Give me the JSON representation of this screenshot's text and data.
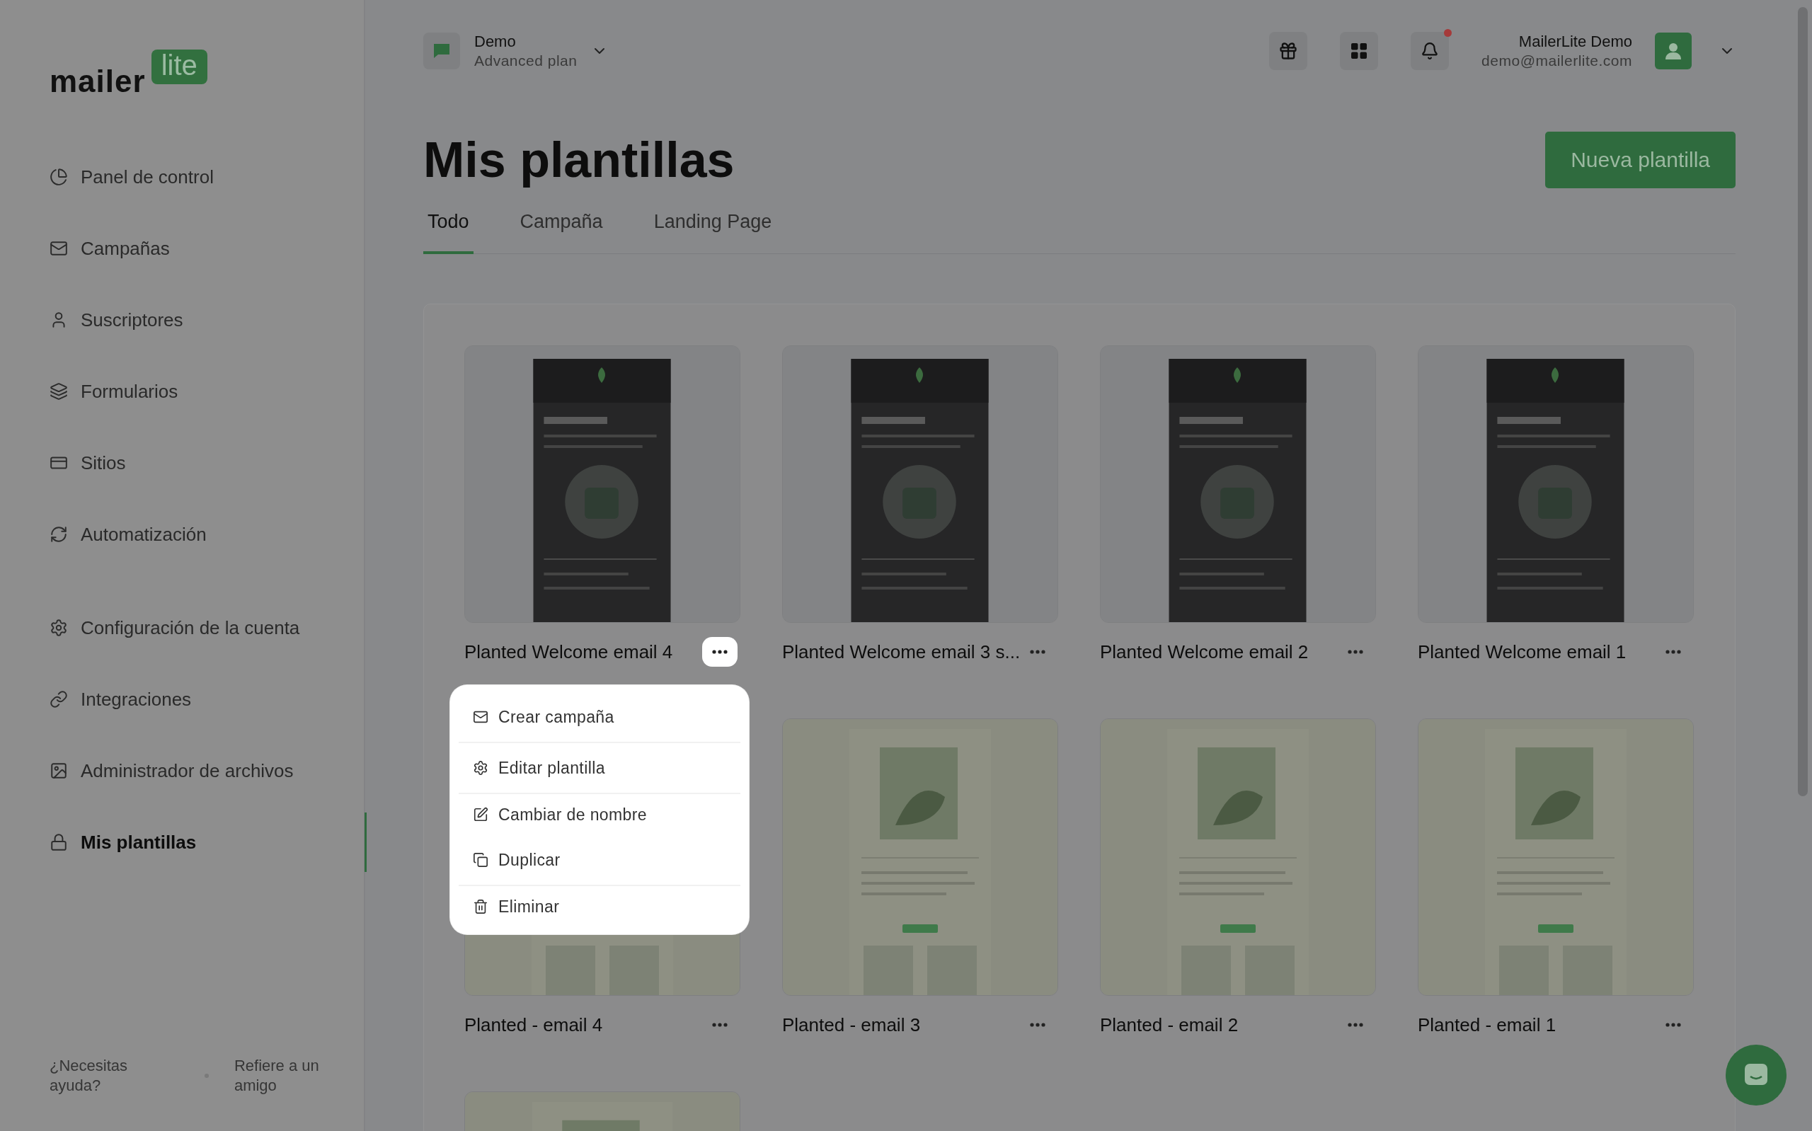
{
  "sidebar": {
    "logo": {
      "word": "mailer",
      "badge": "lite"
    },
    "sections": [
      {
        "items": [
          {
            "label": "Panel de control",
            "selected": false
          },
          {
            "label": "Campañas",
            "selected": false
          },
          {
            "label": "Suscriptores",
            "selected": false
          },
          {
            "label": "Formularios",
            "selected": false
          },
          {
            "label": "Sitios",
            "selected": false
          },
          {
            "label": "Automatización",
            "selected": false
          }
        ]
      },
      {
        "items": [
          {
            "label": "Configuración de la cuenta",
            "selected": false
          },
          {
            "label": "Integraciones",
            "selected": false
          },
          {
            "label": "Administrador de archivos",
            "selected": false
          },
          {
            "label": "Mis plantillas",
            "selected": true
          }
        ]
      }
    ],
    "footer": [
      "¿Necesitas ayuda?",
      "Refiere a un amigo"
    ]
  },
  "header": {
    "workspace": {
      "name": "Demo",
      "plan": "Advanced plan"
    },
    "has_notification": true,
    "user": {
      "name": "MailerLite Demo",
      "email": "demo@mailerlite.com"
    }
  },
  "page": {
    "title": "Mis plantillas",
    "new_button": "Nueva plantilla",
    "tabs": [
      {
        "label": "Todo",
        "selected": true
      },
      {
        "label": "Campaña",
        "selected": false
      },
      {
        "label": "Landing Page",
        "selected": false
      }
    ]
  },
  "templates": [
    {
      "name": "Planted Welcome email 4",
      "kind": "dark",
      "menu_open": true
    },
    {
      "name": "Planted Welcome email 3 s...",
      "kind": "dark",
      "menu_open": false
    },
    {
      "name": "Planted Welcome email 2",
      "kind": "dark",
      "menu_open": false
    },
    {
      "name": "Planted Welcome email 1",
      "kind": "dark",
      "menu_open": false
    },
    {
      "name": "Planted - email 4",
      "kind": "sage",
      "menu_open": false
    },
    {
      "name": "Planted - email 3",
      "kind": "sage",
      "menu_open": false
    },
    {
      "name": "Planted - email 2",
      "kind": "sage",
      "menu_open": false
    },
    {
      "name": "Planted - email 1",
      "kind": "sage",
      "menu_open": false
    },
    {
      "kind": "partial"
    }
  ],
  "context_menu": {
    "items": [
      {
        "label": "Crear campaña",
        "divider_after": true
      },
      {
        "label": "Editar plantilla",
        "divider_after": true
      },
      {
        "label": "Cambiar de nombre",
        "divider_after": false
      },
      {
        "label": "Duplicar",
        "divider_after": true
      },
      {
        "label": "Eliminar",
        "divider_after": false
      }
    ]
  }
}
